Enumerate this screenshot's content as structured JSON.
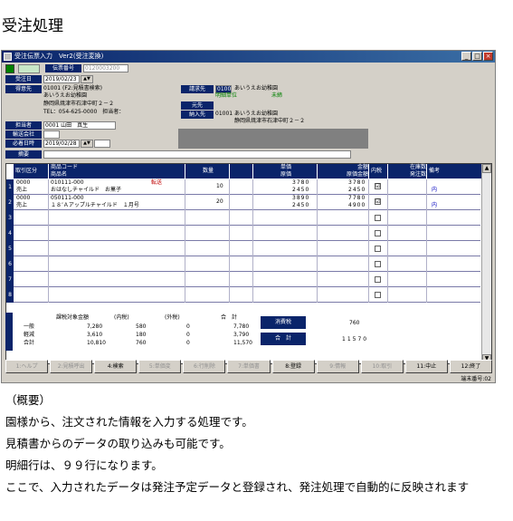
{
  "page_title": "受注処理",
  "window": {
    "title": "受注伝票入力　Ver2(受注変換)",
    "buttons": [
      "_",
      "□",
      "×"
    ]
  },
  "header": {
    "ref_label": "伝票番号",
    "ref_value": "0120003200",
    "order_date_label": "受注日",
    "order_date": "2019/02/23",
    "customer_label": "得意先",
    "customer_code": "01001 (F2:見積書検索)",
    "customer_name": "あいうえお幼稚園",
    "customer_addr": "静岡県焼津市石津中町２－２",
    "customer_tel": "TEL：054-625-0000　担当者：",
    "billing_label": "請求先",
    "billing_code": "01001",
    "billing_name": "あいうえお幼稚園",
    "billing_unit_label": "明細単位",
    "billing_unit_value": "未締",
    "dest_label": "元先",
    "delivery_label": "納入先",
    "delivery_code": "01001",
    "delivery_name": "あいうえお幼稚園",
    "delivery_addr": "静岡県焼津市石津中町２－２",
    "staff_label": "担当者",
    "staff_value": "0001 山田　真生",
    "carrier_label": "輸送会社",
    "due_label": "必着日時",
    "due_value": "2019/02/28",
    "memo_label": "摘要"
  },
  "grid": {
    "headers": {
      "kind": "取引区分",
      "code": "商品コード",
      "name": "商品名",
      "qty": "数量",
      "unit_price": "単価",
      "cost_price": "原価",
      "amount": "金額",
      "cost_amount": "原価金額",
      "tax": "内税",
      "stock": "在庫数",
      "order_qty": "発注数",
      "note": "備考"
    },
    "rows": [
      {
        "no": "1",
        "kind": "0000",
        "kind_name": "売上",
        "code": "010111-000",
        "code_note": "転送",
        "name": "おはなしチャイルド　お菓子",
        "qty": "10",
        "unit_price": "3780",
        "cost_price": "2450",
        "amount": "3780",
        "cost_amount": "2450",
        "tax": "☑",
        "note": "内"
      },
      {
        "no": "2",
        "kind": "0000",
        "kind_name": "売上",
        "code": "050111-000",
        "code_note": "",
        "name": "１８’Ａアップルチャイルド　１月号",
        "qty": "20",
        "unit_price": "3890",
        "cost_price": "2450",
        "amount": "7780",
        "cost_amount": "4900",
        "tax": "☑",
        "note": "内"
      },
      {
        "no": "3"
      },
      {
        "no": "4"
      },
      {
        "no": "5"
      },
      {
        "no": "6"
      },
      {
        "no": "7"
      },
      {
        "no": "8"
      }
    ]
  },
  "summary": {
    "headers": [
      "課税対象金額",
      "(内税)",
      "(外税)",
      "合　計"
    ],
    "rows": [
      {
        "label": "一般",
        "a": "7,280",
        "b": "580",
        "c": "0",
        "d": "7,780"
      },
      {
        "label": "軽減",
        "a": "3,610",
        "b": "180",
        "c": "0",
        "d": "3,790"
      },
      {
        "label": "合計",
        "a": "10,810",
        "b": "760",
        "c": "0",
        "d": "11,570"
      }
    ],
    "tax_label": "消費税",
    "tax_value": "760",
    "total_label": "合　計",
    "total_value": "11570"
  },
  "fkeys": [
    {
      "label": "1:ヘルプ",
      "enabled": false
    },
    {
      "label": "2:見積呼出",
      "enabled": false
    },
    {
      "label": "4:検索",
      "enabled": true
    },
    {
      "label": "5:単価変",
      "enabled": false
    },
    {
      "label": "6:行削除",
      "enabled": false
    },
    {
      "label": "7:単価書",
      "enabled": false
    },
    {
      "label": "8:登録",
      "enabled": true
    },
    {
      "label": "9:情報",
      "enabled": false
    },
    {
      "label": "10:取引",
      "enabled": false
    },
    {
      "label": "11:中止",
      "enabled": true
    },
    {
      "label": "12:終了",
      "enabled": true
    }
  ],
  "status": "端末番号:02",
  "description": {
    "heading": "（概要）",
    "lines": [
      "園様から、注文された情報を入力する処理です。",
      "見積書からのデータの取り込みも可能です。",
      "明細行は、９９行になります。",
      "ここで、入力されたデータは発注予定データと登録され、発注処理で自動的に反映されます"
    ]
  }
}
